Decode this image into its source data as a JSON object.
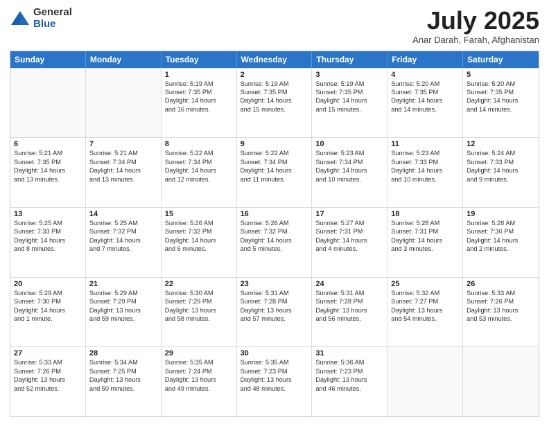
{
  "logo": {
    "general": "General",
    "blue": "Blue"
  },
  "title": "July 2025",
  "subtitle": "Anar Darah, Farah, Afghanistan",
  "headers": [
    "Sunday",
    "Monday",
    "Tuesday",
    "Wednesday",
    "Thursday",
    "Friday",
    "Saturday"
  ],
  "weeks": [
    [
      {
        "day": "",
        "lines": []
      },
      {
        "day": "",
        "lines": []
      },
      {
        "day": "1",
        "lines": [
          "Sunrise: 5:19 AM",
          "Sunset: 7:35 PM",
          "Daylight: 14 hours",
          "and 16 minutes."
        ]
      },
      {
        "day": "2",
        "lines": [
          "Sunrise: 5:19 AM",
          "Sunset: 7:35 PM",
          "Daylight: 14 hours",
          "and 15 minutes."
        ]
      },
      {
        "day": "3",
        "lines": [
          "Sunrise: 5:19 AM",
          "Sunset: 7:35 PM",
          "Daylight: 14 hours",
          "and 15 minutes."
        ]
      },
      {
        "day": "4",
        "lines": [
          "Sunrise: 5:20 AM",
          "Sunset: 7:35 PM",
          "Daylight: 14 hours",
          "and 14 minutes."
        ]
      },
      {
        "day": "5",
        "lines": [
          "Sunrise: 5:20 AM",
          "Sunset: 7:35 PM",
          "Daylight: 14 hours",
          "and 14 minutes."
        ]
      }
    ],
    [
      {
        "day": "6",
        "lines": [
          "Sunrise: 5:21 AM",
          "Sunset: 7:35 PM",
          "Daylight: 14 hours",
          "and 13 minutes."
        ]
      },
      {
        "day": "7",
        "lines": [
          "Sunrise: 5:21 AM",
          "Sunset: 7:34 PM",
          "Daylight: 14 hours",
          "and 13 minutes."
        ]
      },
      {
        "day": "8",
        "lines": [
          "Sunrise: 5:22 AM",
          "Sunset: 7:34 PM",
          "Daylight: 14 hours",
          "and 12 minutes."
        ]
      },
      {
        "day": "9",
        "lines": [
          "Sunrise: 5:22 AM",
          "Sunset: 7:34 PM",
          "Daylight: 14 hours",
          "and 11 minutes."
        ]
      },
      {
        "day": "10",
        "lines": [
          "Sunrise: 5:23 AM",
          "Sunset: 7:34 PM",
          "Daylight: 14 hours",
          "and 10 minutes."
        ]
      },
      {
        "day": "11",
        "lines": [
          "Sunrise: 5:23 AM",
          "Sunset: 7:33 PM",
          "Daylight: 14 hours",
          "and 10 minutes."
        ]
      },
      {
        "day": "12",
        "lines": [
          "Sunrise: 5:24 AM",
          "Sunset: 7:33 PM",
          "Daylight: 14 hours",
          "and 9 minutes."
        ]
      }
    ],
    [
      {
        "day": "13",
        "lines": [
          "Sunrise: 5:25 AM",
          "Sunset: 7:33 PM",
          "Daylight: 14 hours",
          "and 8 minutes."
        ]
      },
      {
        "day": "14",
        "lines": [
          "Sunrise: 5:25 AM",
          "Sunset: 7:32 PM",
          "Daylight: 14 hours",
          "and 7 minutes."
        ]
      },
      {
        "day": "15",
        "lines": [
          "Sunrise: 5:26 AM",
          "Sunset: 7:32 PM",
          "Daylight: 14 hours",
          "and 6 minutes."
        ]
      },
      {
        "day": "16",
        "lines": [
          "Sunrise: 5:26 AM",
          "Sunset: 7:32 PM",
          "Daylight: 14 hours",
          "and 5 minutes."
        ]
      },
      {
        "day": "17",
        "lines": [
          "Sunrise: 5:27 AM",
          "Sunset: 7:31 PM",
          "Daylight: 14 hours",
          "and 4 minutes."
        ]
      },
      {
        "day": "18",
        "lines": [
          "Sunrise: 5:28 AM",
          "Sunset: 7:31 PM",
          "Daylight: 14 hours",
          "and 3 minutes."
        ]
      },
      {
        "day": "19",
        "lines": [
          "Sunrise: 5:28 AM",
          "Sunset: 7:30 PM",
          "Daylight: 14 hours",
          "and 2 minutes."
        ]
      }
    ],
    [
      {
        "day": "20",
        "lines": [
          "Sunrise: 5:29 AM",
          "Sunset: 7:30 PM",
          "Daylight: 14 hours",
          "and 1 minute."
        ]
      },
      {
        "day": "21",
        "lines": [
          "Sunrise: 5:29 AM",
          "Sunset: 7:29 PM",
          "Daylight: 13 hours",
          "and 59 minutes."
        ]
      },
      {
        "day": "22",
        "lines": [
          "Sunrise: 5:30 AM",
          "Sunset: 7:29 PM",
          "Daylight: 13 hours",
          "and 58 minutes."
        ]
      },
      {
        "day": "23",
        "lines": [
          "Sunrise: 5:31 AM",
          "Sunset: 7:28 PM",
          "Daylight: 13 hours",
          "and 57 minutes."
        ]
      },
      {
        "day": "24",
        "lines": [
          "Sunrise: 5:31 AM",
          "Sunset: 7:28 PM",
          "Daylight: 13 hours",
          "and 56 minutes."
        ]
      },
      {
        "day": "25",
        "lines": [
          "Sunrise: 5:32 AM",
          "Sunset: 7:27 PM",
          "Daylight: 13 hours",
          "and 54 minutes."
        ]
      },
      {
        "day": "26",
        "lines": [
          "Sunrise: 5:33 AM",
          "Sunset: 7:26 PM",
          "Daylight: 13 hours",
          "and 53 minutes."
        ]
      }
    ],
    [
      {
        "day": "27",
        "lines": [
          "Sunrise: 5:33 AM",
          "Sunset: 7:26 PM",
          "Daylight: 13 hours",
          "and 52 minutes."
        ]
      },
      {
        "day": "28",
        "lines": [
          "Sunrise: 5:34 AM",
          "Sunset: 7:25 PM",
          "Daylight: 13 hours",
          "and 50 minutes."
        ]
      },
      {
        "day": "29",
        "lines": [
          "Sunrise: 5:35 AM",
          "Sunset: 7:24 PM",
          "Daylight: 13 hours",
          "and 49 minutes."
        ]
      },
      {
        "day": "30",
        "lines": [
          "Sunrise: 5:35 AM",
          "Sunset: 7:23 PM",
          "Daylight: 13 hours",
          "and 48 minutes."
        ]
      },
      {
        "day": "31",
        "lines": [
          "Sunrise: 5:36 AM",
          "Sunset: 7:23 PM",
          "Daylight: 13 hours",
          "and 46 minutes."
        ]
      },
      {
        "day": "",
        "lines": []
      },
      {
        "day": "",
        "lines": []
      }
    ]
  ]
}
